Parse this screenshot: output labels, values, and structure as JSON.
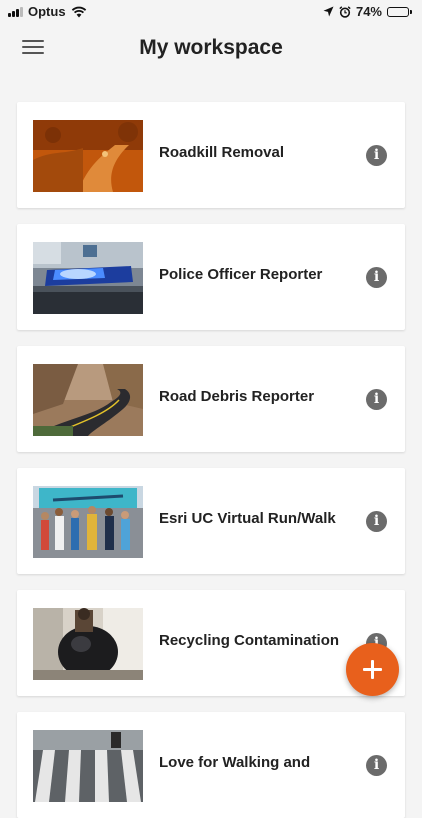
{
  "status_bar": {
    "carrier": "Optus",
    "battery_percent": "74%",
    "battery_level": 0.74
  },
  "header": {
    "title": "My workspace",
    "menu_icon": "hamburger-menu-icon"
  },
  "surveys": [
    {
      "label": "Roadkill Removal",
      "thumbnail": "orange-night-road-photo"
    },
    {
      "label": "Police Officer Reporter",
      "thumbnail": "police-light-bar-photo"
    },
    {
      "label": "Road Debris Reporter",
      "thumbnail": "winding-road-photo"
    },
    {
      "label": "Esri UC Virtual Run/Walk",
      "thumbnail": "runners-start-banner-photo"
    },
    {
      "label": "Recycling Contamination",
      "thumbnail": "trash-bag-photo"
    },
    {
      "label": "Love for Walking and",
      "thumbnail": "crosswalk-photo"
    }
  ],
  "fab": {
    "icon": "plus-icon"
  },
  "colors": {
    "accent": "#e8601c",
    "background": "#f4f4f4",
    "card": "#ffffff",
    "info_icon": "#6b6b6b"
  }
}
